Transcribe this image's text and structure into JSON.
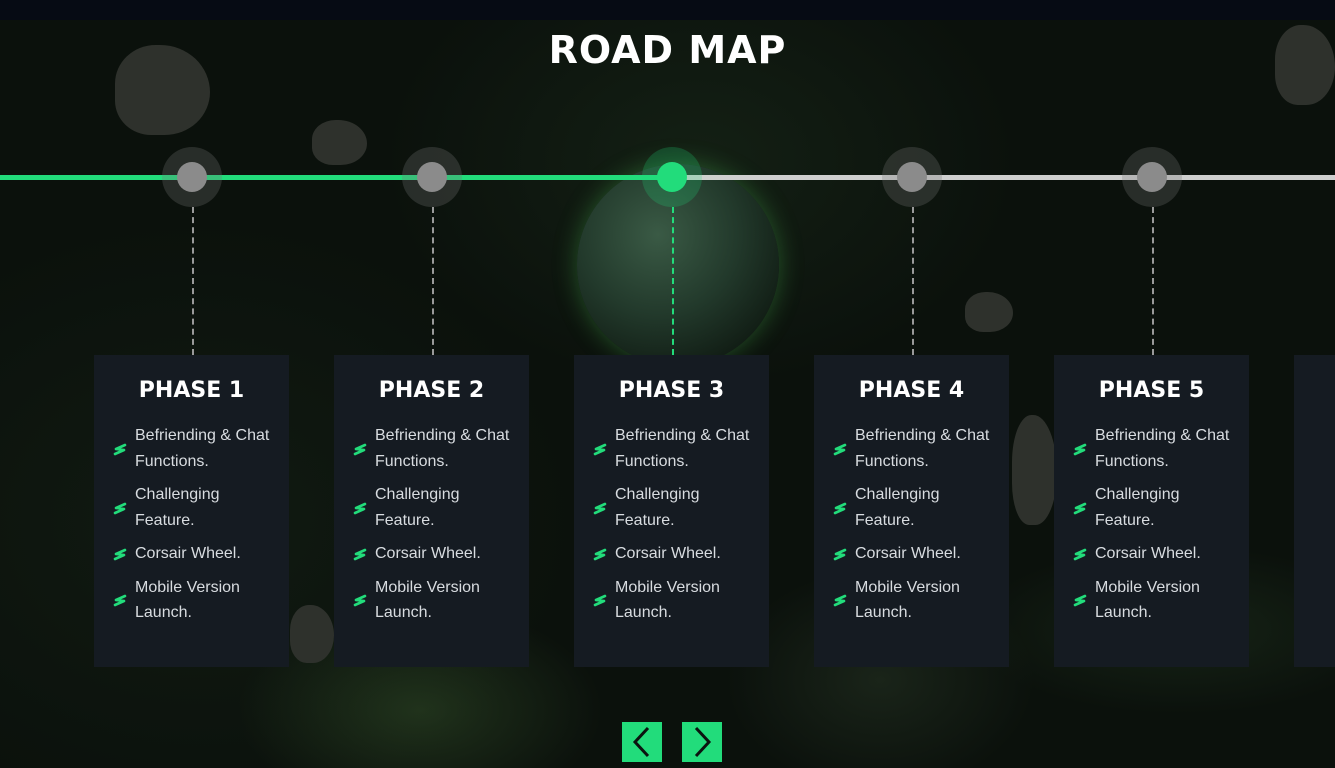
{
  "title": "ROAD MAP",
  "colors": {
    "accent": "#22dc7b",
    "card_bg": "#151b22",
    "inactive_line": "#cfcfcf"
  },
  "active_phase": 3,
  "phases": [
    {
      "title": "PHASE 1",
      "items": [
        "Befriending & Chat Functions.",
        "Challenging Feature.",
        "Corsair Wheel.",
        "Mobile Version Launch."
      ]
    },
    {
      "title": "PHASE 2",
      "items": [
        "Befriending & Chat Functions.",
        "Challenging Feature.",
        "Corsair Wheel.",
        "Mobile Version Launch."
      ]
    },
    {
      "title": "PHASE 3",
      "items": [
        "Befriending & Chat Functions.",
        "Challenging Feature.",
        "Corsair Wheel.",
        "Mobile Version Launch."
      ]
    },
    {
      "title": "PHASE 4",
      "items": [
        "Befriending & Chat Functions.",
        "Challenging Feature.",
        "Corsair Wheel.",
        "Mobile Version Launch."
      ]
    },
    {
      "title": "PHASE 5",
      "items": [
        "Befriending & Chat Functions.",
        "Challenging Feature.",
        "Corsair Wheel.",
        "Mobile Version Launch."
      ]
    }
  ],
  "nav": {
    "prev_icon": "chevron-left-icon",
    "next_icon": "chevron-right-icon"
  }
}
